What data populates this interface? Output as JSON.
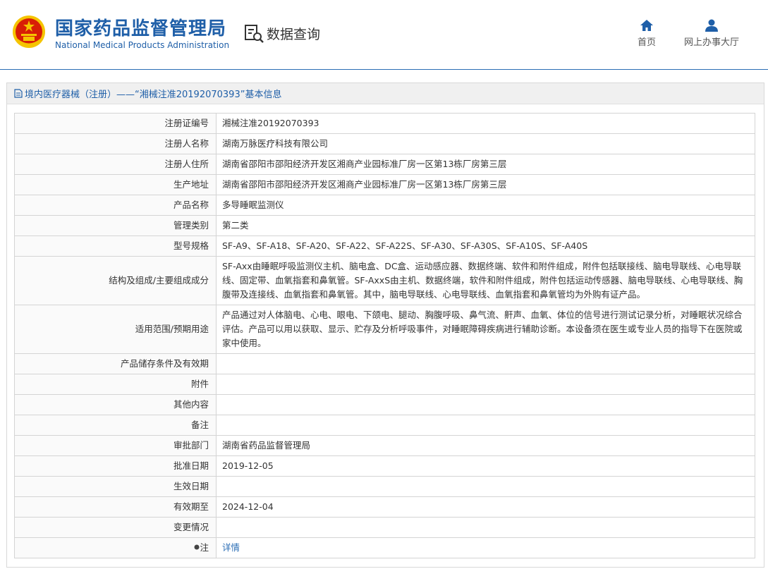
{
  "header": {
    "org_name_cn": "国家药品监督管理局",
    "org_name_en": "National Medical Products Administration",
    "query_label": "数据查询",
    "nav": [
      {
        "label": "首页",
        "icon": "home-icon"
      },
      {
        "label": "网上办事大厅",
        "icon": "user-icon"
      }
    ]
  },
  "panel": {
    "title": "境内医疗器械（注册）——“湘械注准20192070393”基本信息"
  },
  "rows": [
    {
      "key": "注册证编号",
      "value": "湘械注准20192070393"
    },
    {
      "key": "注册人名称",
      "value": "湖南万脉医疗科技有限公司"
    },
    {
      "key": "注册人住所",
      "value": "湖南省邵阳市邵阳经济开发区湘商产业园标准厂房一区第13栋厂房第三层"
    },
    {
      "key": "生产地址",
      "value": "湖南省邵阳市邵阳经济开发区湘商产业园标准厂房一区第13栋厂房第三层"
    },
    {
      "key": "产品名称",
      "value": "多导睡眠监测仪"
    },
    {
      "key": "管理类别",
      "value": "第二类"
    },
    {
      "key": "型号规格",
      "value": "SF-A9、SF-A18、SF-A20、SF-A22、SF-A22S、SF-A30、SF-A30S、SF-A10S、SF-A40S"
    },
    {
      "key": "结构及组成/主要组成成分",
      "value": "SF-Axx由睡眠呼吸监测仪主机、脑电盒、DC盒、运动感应器、数据终端、软件和附件组成，附件包括联接线、脑电导联线、心电导联线、固定带、血氧指套和鼻氧管。SF-AxxS由主机、数据终端，软件和附件组成，附件包括运动传感器、脑电导联线、心电导联线、胸腹带及连接线、血氧指套和鼻氧管。其中，脑电导联线、心电导联线、血氧指套和鼻氧管均为外购有证产品。"
    },
    {
      "key": "适用范围/预期用途",
      "value": "产品通过对人体脑电、心电、眼电、下颌电、腿动、胸腹呼吸、鼻气流、鼾声、血氧、体位的信号进行测试记录分析，对睡眠状况综合评估。产品可以用以获取、显示、贮存及分析呼吸事件，对睡眠障碍疾病进行辅助诊断。本设备须在医生或专业人员的指导下在医院或家中使用。"
    },
    {
      "key": "产品储存条件及有效期",
      "value": ""
    },
    {
      "key": "附件",
      "value": ""
    },
    {
      "key": "其他内容",
      "value": ""
    },
    {
      "key": "备注",
      "value": ""
    },
    {
      "key": "审批部门",
      "value": "湖南省药品监督管理局"
    },
    {
      "key": "批准日期",
      "value": "2019-12-05"
    },
    {
      "key": "生效日期",
      "value": ""
    },
    {
      "key": "有效期至",
      "value": "2024-12-04"
    },
    {
      "key": "变更情况",
      "value": ""
    }
  ],
  "note_row": {
    "key": "注",
    "link_text": "详情"
  },
  "colors": {
    "brand_blue": "#1f5fa8",
    "emblem_red": "#d81e06",
    "emblem_gold": "#f5c400"
  }
}
